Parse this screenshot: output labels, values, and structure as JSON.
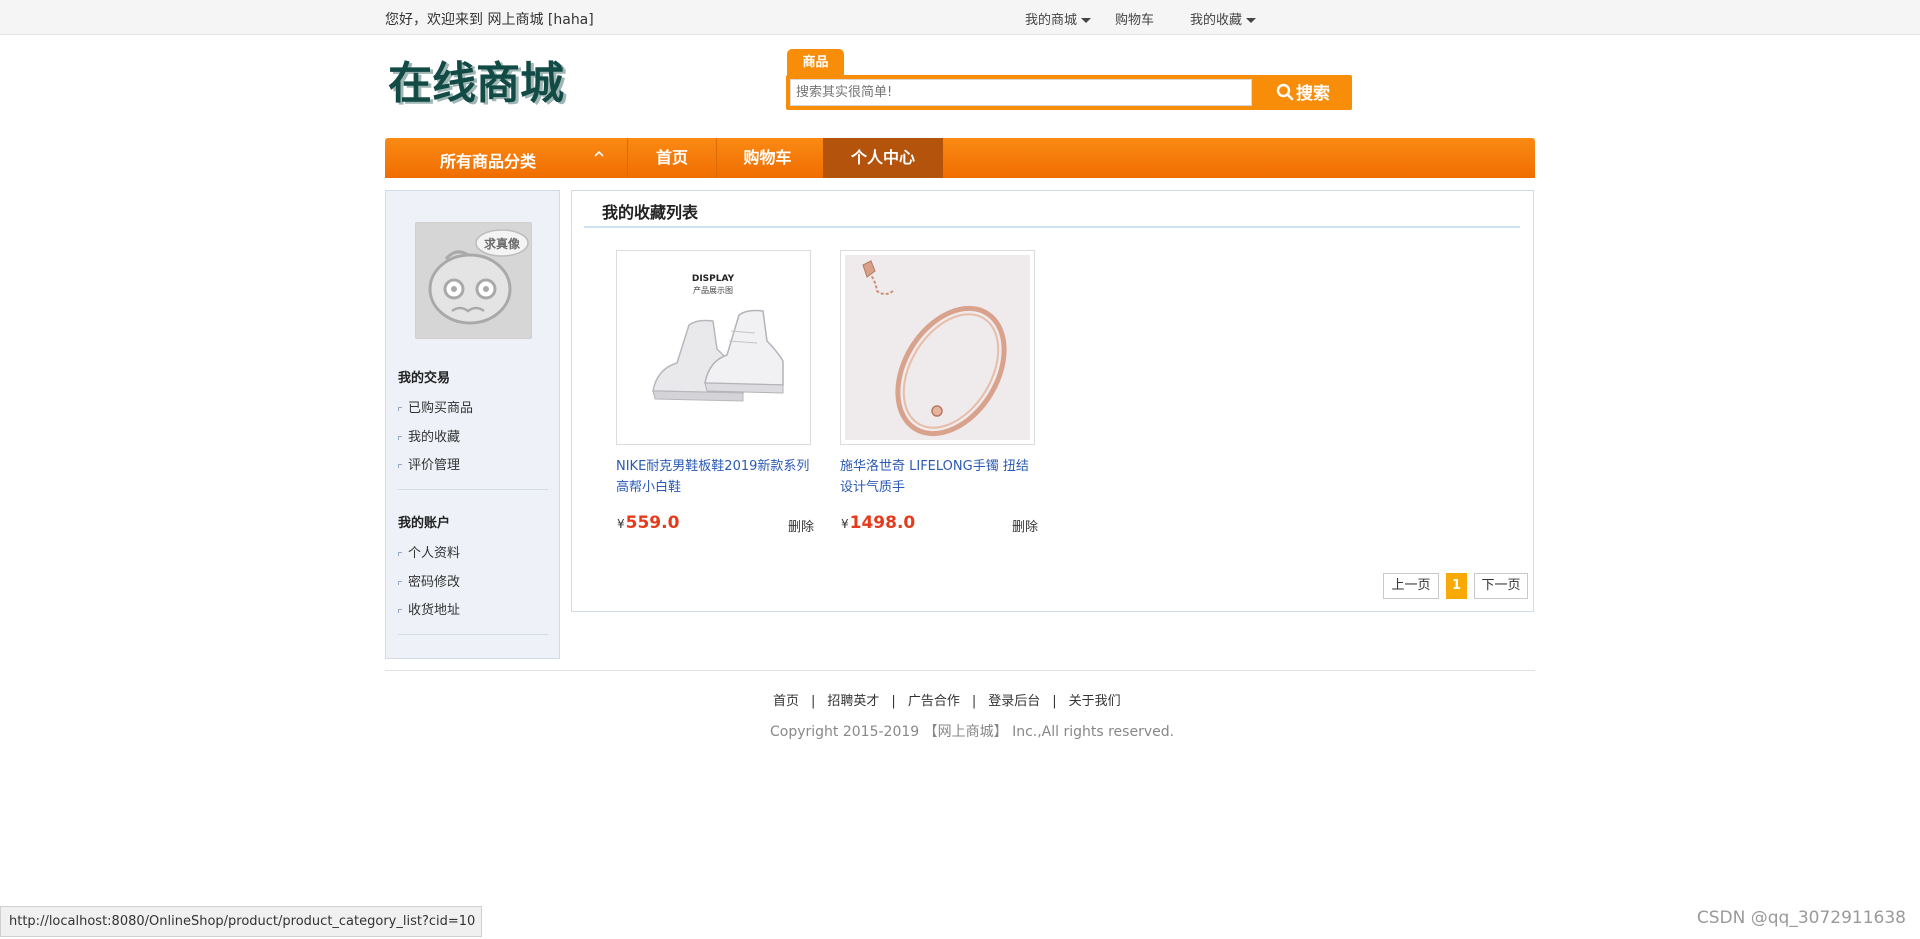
{
  "topbar": {
    "welcome": "您好，欢迎来到 网上商城  [haha]",
    "links": [
      "我的商城",
      "购物车",
      "我的收藏"
    ]
  },
  "header": {
    "logo_text": "在线商城",
    "search_tab": "商品",
    "search_placeholder": "搜索其实很简单!",
    "search_button": "搜索"
  },
  "nav": {
    "category_label": "所有商品分类",
    "items": [
      "首页",
      "购物车",
      "个人中心"
    ],
    "active_index": 2
  },
  "sidebar": {
    "avatar_badge": "求真像",
    "sections": [
      {
        "title": "我的交易",
        "links": [
          "已购买商品",
          "我的收藏",
          "评价管理"
        ]
      },
      {
        "title": "我的账户",
        "links": [
          "个人资料",
          "密码修改",
          "收货地址"
        ]
      }
    ]
  },
  "main": {
    "title": "我的收藏列表",
    "products": [
      {
        "name": "NIKE耐克男鞋板鞋2019新款系列高帮小白鞋",
        "currency": "¥",
        "price": "559.0",
        "delete": "删除",
        "thumb_text_1": "DISPLAY",
        "thumb_text_2": "产品展示图"
      },
      {
        "name": "施华洛世奇 LIFELONG手镯 扭结设计气质手",
        "currency": "¥",
        "price": "1498.0",
        "delete": "删除"
      }
    ],
    "pagination": {
      "prev": "上一页",
      "current": "1",
      "next": "下一页"
    }
  },
  "footer": {
    "links": [
      "首页",
      "招聘英才",
      "广告合作",
      "登录后台",
      "关于我们"
    ],
    "copyright": "Copyright 2015-2019 【网上商城】 Inc.,All rights reserved."
  },
  "statusbar": {
    "url": "http://localhost:8080/OnlineShop/product/product_category_list?cid=10"
  },
  "watermark": "CSDN @qq_3072911638",
  "colors": {
    "accent": "#f88d09",
    "nav_active": "#b4530b",
    "price": "#e53b1b",
    "link": "#2a5ab3"
  }
}
